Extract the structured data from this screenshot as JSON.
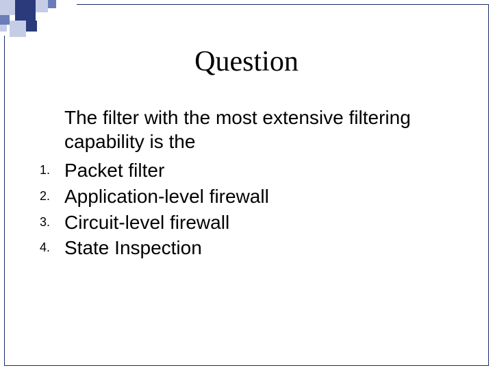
{
  "title": "Question",
  "question": "The filter with the most extensive filtering capability is the",
  "options": [
    {
      "num": "1.",
      "text": "Packet filter"
    },
    {
      "num": "2.",
      "text": "Application-level firewall"
    },
    {
      "num": "3.",
      "text": "Circuit-level firewall"
    },
    {
      "num": "4.",
      "text": "State Inspection"
    }
  ],
  "deco_colors": {
    "dark": "#2a3a7a",
    "mid": "#6b7db8",
    "light": "#c5cde6"
  }
}
